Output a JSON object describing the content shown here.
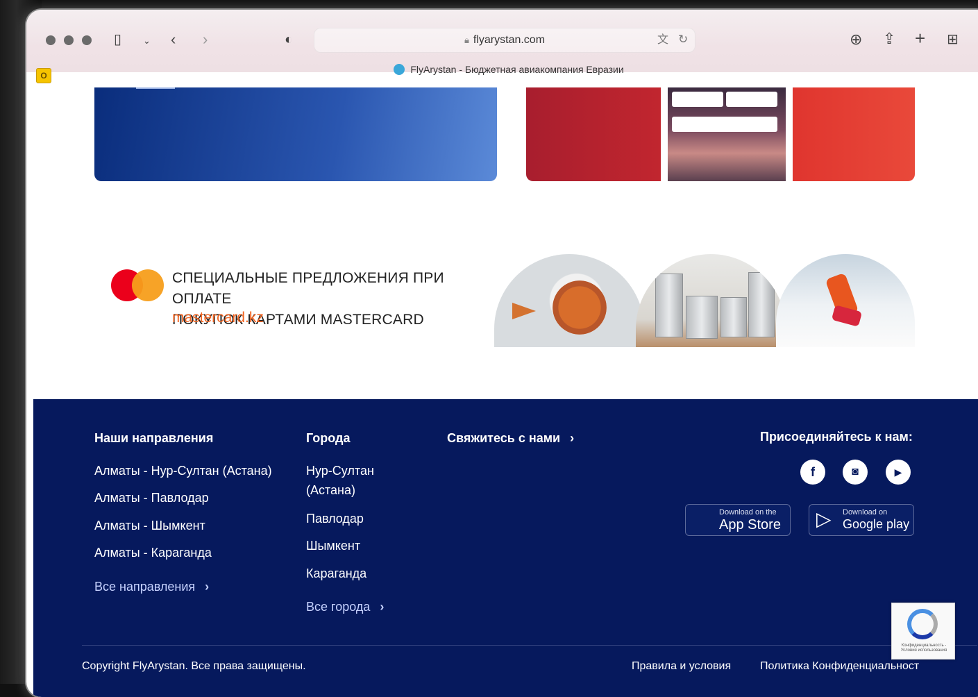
{
  "browser": {
    "url": "flyarystan.com",
    "tab_title": "FlyArystan - Бюджетная авиакомпания Евразии"
  },
  "mastercard": {
    "line1": "СПЕЦИАЛЬНЫЕ ПРЕДЛОЖЕНИЯ ПРИ ОПЛАТЕ",
    "line2": "ПОКУПОК КАРТАМИ MASTERCARD",
    "url": "mastercard.kz"
  },
  "footer": {
    "routes": {
      "heading": "Наши направления",
      "items": [
        "Алматы - Нур-Султан (Астана)",
        "Алматы - Павлодар",
        "Алматы - Шымкент",
        "Алматы - Караганда"
      ],
      "more": "Все направления"
    },
    "cities": {
      "heading": "Города",
      "items": [
        "Нур-Султан (Астана)",
        "Павлодар",
        "Шымкент",
        "Караганда"
      ],
      "more": "Все города"
    },
    "contact": "Свяжитесь с нами",
    "join": "Присоединяйтесь к нам:",
    "social": [
      "facebook-icon",
      "instagram-icon",
      "youtube-icon"
    ],
    "appstore": {
      "small": "Download on the",
      "big": "App Store"
    },
    "googleplay": {
      "small": "Download on",
      "big": "Google play"
    },
    "copyright": "Copyright FlyArystan. Все права защищены.",
    "terms": "Правила и условия",
    "privacy": "Политика Конфиденциальност"
  },
  "recaptcha": {
    "text": "Конфиденциальность - Условия использования"
  },
  "colors": {
    "footer_bg": "#06195d",
    "mastercard_red": "#eb001b",
    "mastercard_orange": "#f79e1b",
    "mastercard_url": "#f26522"
  }
}
